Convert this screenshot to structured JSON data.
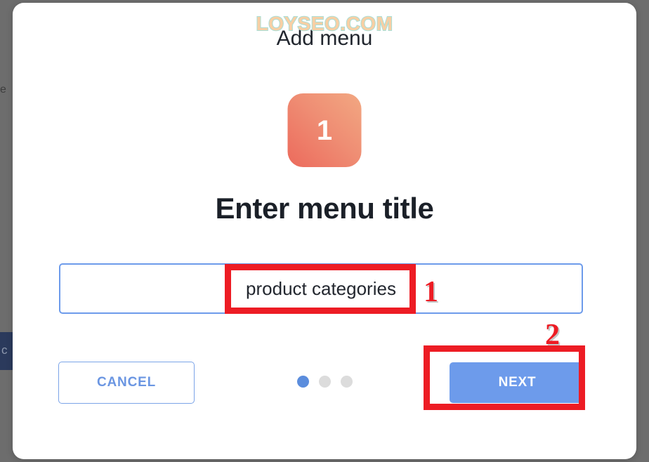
{
  "background": {
    "text_fragment": "e",
    "navy_glyph": "c"
  },
  "modal": {
    "watermark": "LOYSEO.COM",
    "title": "Add menu",
    "step_badge": {
      "number": "1",
      "gradient_from": "#f2a882",
      "gradient_to": "#ec6a5c"
    },
    "heading": "Enter menu title",
    "input": {
      "value": "product categories",
      "placeholder": "",
      "border_color": "#6d9beb"
    },
    "pagination": {
      "total": 3,
      "active_index": 0,
      "active_color": "#5b8ddd",
      "inactive_color": "#dcdcdc"
    },
    "buttons": {
      "cancel_label": "CANCEL",
      "cancel_text_color": "#6b96e2",
      "next_label": "NEXT",
      "next_background": "#6d9beb"
    }
  },
  "annotations": {
    "color": "#ed1c24",
    "marker_1": "1",
    "marker_2": "2"
  }
}
